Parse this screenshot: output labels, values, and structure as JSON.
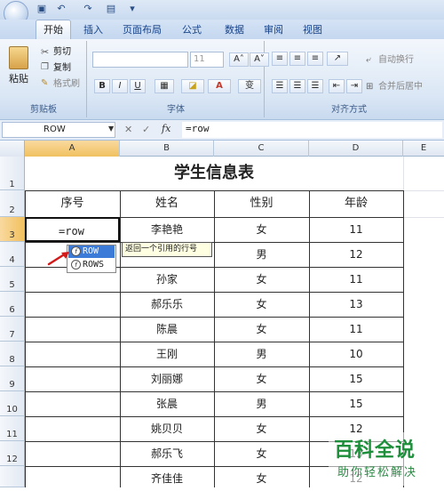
{
  "quick_access": {
    "icons": [
      "save-icon",
      "undo-icon",
      "redo-icon",
      "print-preview-icon",
      "customize-icon"
    ]
  },
  "tabs": [
    {
      "label": "开始",
      "active": true
    },
    {
      "label": "插入"
    },
    {
      "label": "页面布局"
    },
    {
      "label": "公式"
    },
    {
      "label": "数据"
    },
    {
      "label": "审阅"
    },
    {
      "label": "视图"
    }
  ],
  "ribbon": {
    "clipboard": {
      "paste": "粘贴",
      "cut": "剪切",
      "copy": "复制",
      "format_painter": "格式刷",
      "group": "剪贴板"
    },
    "font": {
      "size": "11",
      "bold": "B",
      "italic": "I",
      "underline": "U",
      "grow": "A˄",
      "shrink": "A˅",
      "group": "字体"
    },
    "alignment": {
      "wrap": "自动换行",
      "merge": "合并后居中",
      "group": "对齐方式"
    }
  },
  "formula_bar": {
    "name_box": "ROW",
    "fx": "fx",
    "content": "=row"
  },
  "columns": [
    "A",
    "B",
    "C",
    "D",
    "E"
  ],
  "rows": [
    "1",
    "2",
    "3",
    "4",
    "5",
    "6",
    "7",
    "8",
    "9",
    "10",
    "11",
    "12"
  ],
  "sheet": {
    "title": "学生信息表",
    "headers": [
      "序号",
      "姓名",
      "性别",
      "年龄"
    ],
    "active_cell_text": "=row",
    "data": [
      {
        "name": "李艳艳",
        "gender": "女",
        "age": "11"
      },
      {
        "name": "",
        "gender": "男",
        "age": "12"
      },
      {
        "name": "孙家",
        "gender": "女",
        "age": "11"
      },
      {
        "name": "郝乐乐",
        "gender": "女",
        "age": "13"
      },
      {
        "name": "陈晨",
        "gender": "女",
        "age": "11"
      },
      {
        "name": "王刚",
        "gender": "男",
        "age": "10"
      },
      {
        "name": "刘丽娜",
        "gender": "女",
        "age": "15"
      },
      {
        "name": "张晨",
        "gender": "男",
        "age": "15"
      },
      {
        "name": "姚贝贝",
        "gender": "女",
        "age": "12"
      },
      {
        "name": "郝乐飞",
        "gender": "女",
        "age": "13"
      },
      {
        "name": "齐佳佳",
        "gender": "女",
        "age": "12"
      }
    ]
  },
  "autocomplete": {
    "items": [
      "ROW",
      "ROWS"
    ],
    "tooltip": "返回一个引用的行号"
  },
  "watermark": {
    "main": "百科全说",
    "sub": "助你轻松解决"
  }
}
